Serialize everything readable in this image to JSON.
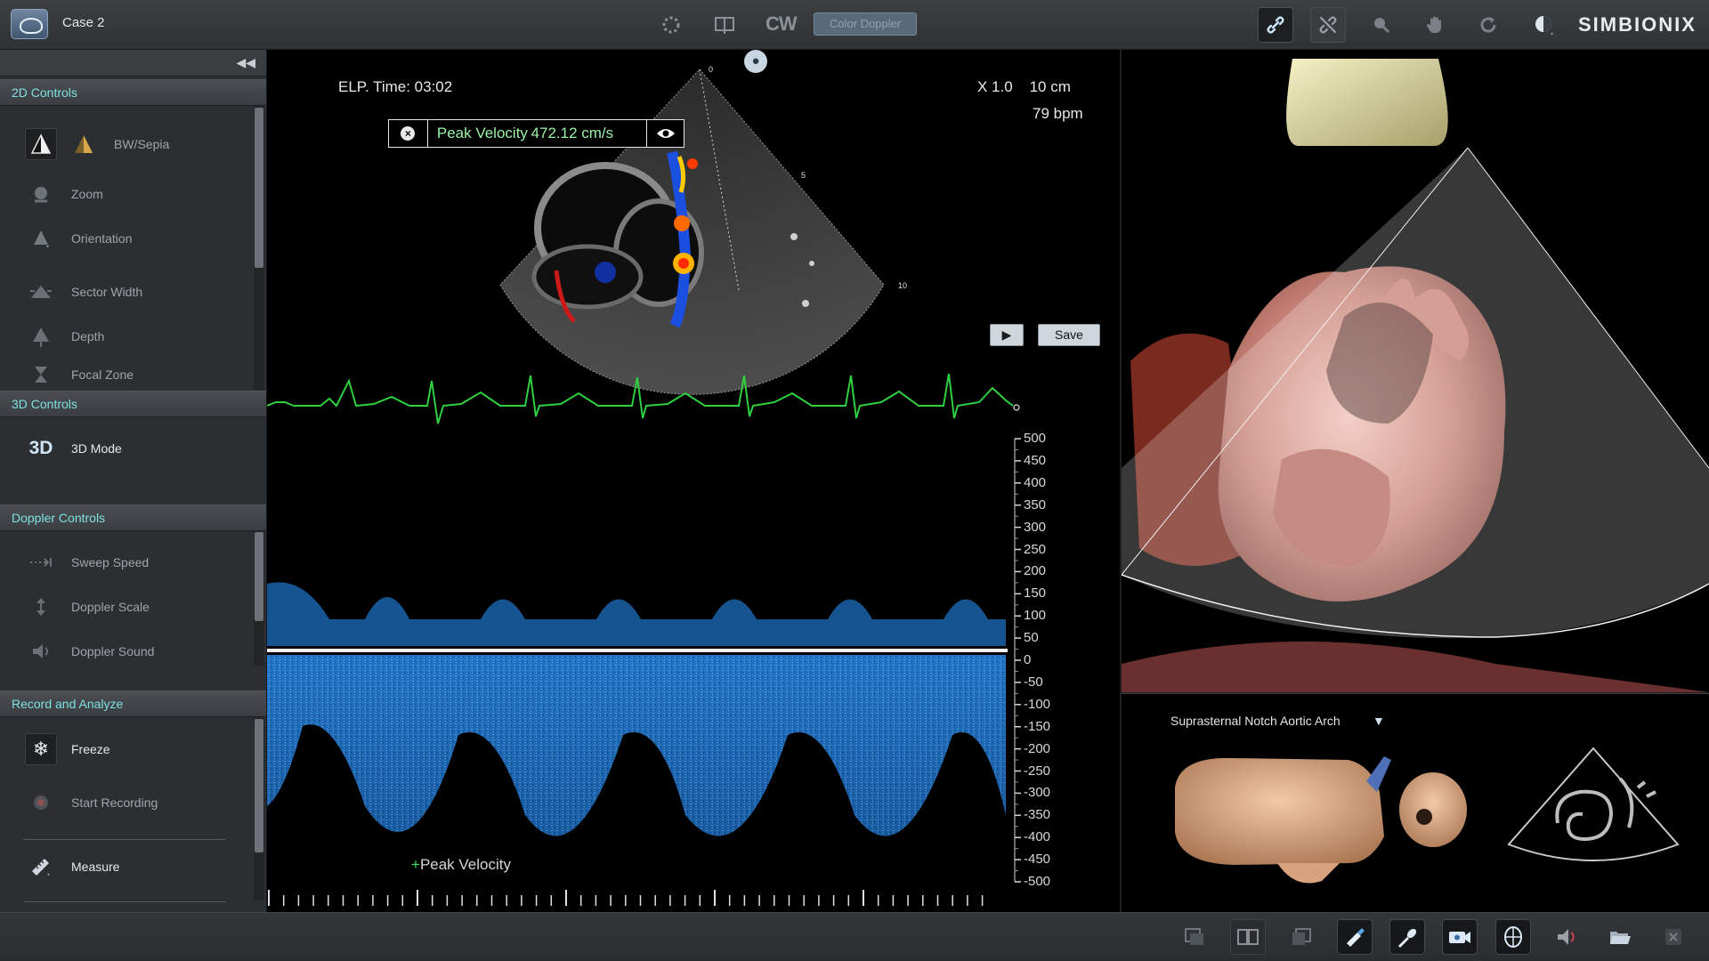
{
  "app": {
    "case_title": "Case 2",
    "brand": "SIMBIONIX"
  },
  "toolbar": {
    "mode_label": "CW",
    "color_doppler_label": "Color Doppler"
  },
  "left_panel": {
    "sections": {
      "controls_2d": "2D Controls",
      "controls_3d": "3D Controls",
      "doppler": "Doppler Controls",
      "record": "Record and Analyze"
    },
    "items_2d": [
      {
        "label": "BW/Sepia",
        "icon": "bw-sepia-icon"
      },
      {
        "label": "Zoom",
        "icon": "zoom-icon"
      },
      {
        "label": "Orientation",
        "icon": "orientation-icon"
      },
      {
        "label": "Sector Width",
        "icon": "sector-width-icon"
      },
      {
        "label": "Depth",
        "icon": "depth-icon"
      },
      {
        "label": "Focal Zone",
        "icon": "focal-zone-icon"
      }
    ],
    "items_3d": [
      {
        "label": "3D Mode",
        "icon": "3d-mode-icon",
        "icon_text": "3D"
      }
    ],
    "items_doppler": [
      {
        "label": "Sweep Speed",
        "icon": "sweep-speed-icon"
      },
      {
        "label": "Doppler Scale",
        "icon": "doppler-scale-icon"
      },
      {
        "label": "Doppler Sound",
        "icon": "doppler-sound-icon"
      }
    ],
    "items_record": [
      {
        "label": "Freeze",
        "icon": "freeze-icon"
      },
      {
        "label": "Start Recording",
        "icon": "record-icon"
      },
      {
        "label": "Measure",
        "icon": "measure-icon"
      }
    ]
  },
  "echo": {
    "elapsed": "ELP. Time: 03:02",
    "zoom_depth": "X 1.0    10 cm",
    "heart_rate": "79 bpm",
    "measurement": {
      "label": "Peak Velocity",
      "value": "472.12 cm/s"
    },
    "save_label": "Save",
    "marker_label": "Peak Velocity",
    "sector_depth_ticks": [
      "0",
      "5",
      "10"
    ],
    "velocity_axis": {
      "unit_note": "",
      "ticks": [
        500,
        450,
        400,
        350,
        300,
        250,
        200,
        150,
        100,
        50,
        0,
        -50,
        -100,
        -150,
        -200,
        -250,
        -300,
        -350,
        -400,
        -450,
        -500
      ]
    }
  },
  "view": {
    "name": "Suprasternal Notch Aortic Arch"
  },
  "colors": {
    "accent_section": "#7fe0e0",
    "ecg": "#2fd040",
    "doppler": "#2f8fe0",
    "measurement_text": "#9af0a6"
  }
}
